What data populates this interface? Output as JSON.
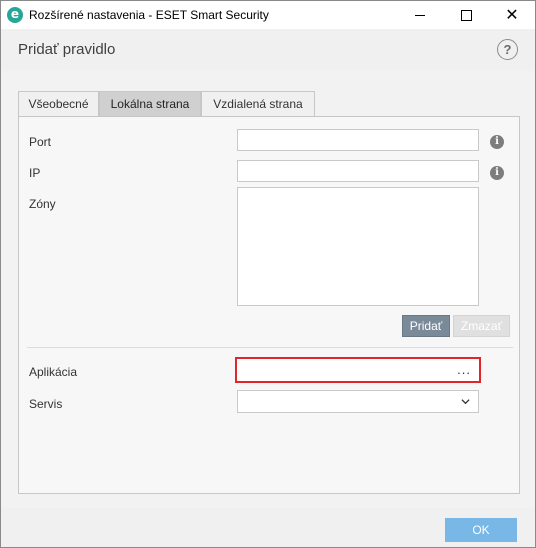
{
  "window": {
    "title": "Rozšírené nastavenia - ESET Smart Security",
    "app_icon_glyph": "e"
  },
  "header": {
    "title": "Pridať pravidlo",
    "help_glyph": "?"
  },
  "tabs": [
    {
      "label": "Všeobecné",
      "selected": false
    },
    {
      "label": "Lokálna strana",
      "selected": true
    },
    {
      "label": "Vzdialená strana",
      "selected": false
    }
  ],
  "form": {
    "port_label": "Port",
    "port_value": "",
    "ip_label": "IP",
    "ip_value": "",
    "zones_label": "Zóny",
    "info_glyph": "i",
    "add_button": "Pridať",
    "remove_button": "Zmazať",
    "application_label": "Aplikácia",
    "application_value": "",
    "browse_button": "...",
    "service_label": "Servis",
    "service_value": ""
  },
  "footer": {
    "ok_button": "OK"
  },
  "colors": {
    "accent": "#78b7e6",
    "highlight_border": "#e0262a",
    "brand": "#26a69a"
  }
}
